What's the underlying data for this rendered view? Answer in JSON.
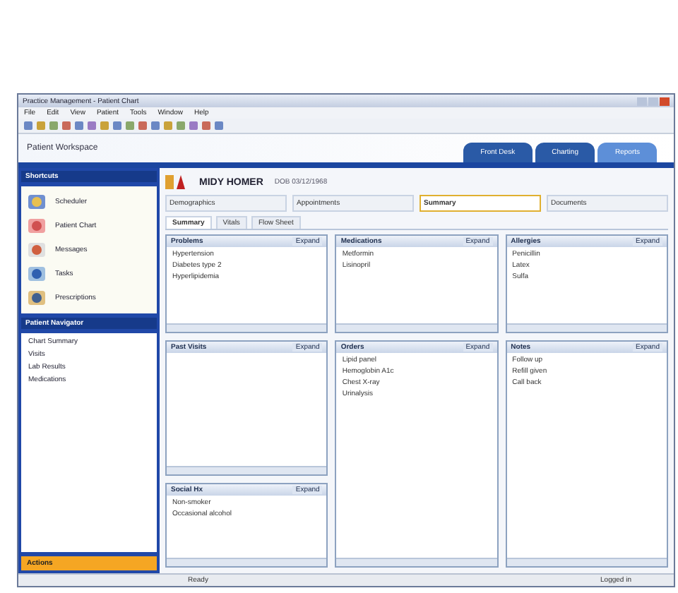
{
  "window": {
    "title": "Practice Management - Patient Chart"
  },
  "menu": [
    "File",
    "Edit",
    "View",
    "Patient",
    "Tools",
    "Window",
    "Help"
  ],
  "app_title": "Patient Workspace",
  "nav_tabs": [
    {
      "label": "Front Desk",
      "selected": false
    },
    {
      "label": "Charting",
      "selected": false
    },
    {
      "label": "Reports",
      "selected": true
    }
  ],
  "sidebar": {
    "title": "Shortcuts",
    "items": [
      "Scheduler",
      "Patient Chart",
      "Messages",
      "Tasks",
      "Prescriptions"
    ],
    "navigator": {
      "title": "Patient Navigator",
      "items": [
        "Chart Summary",
        "Visits",
        "Lab Results",
        "Medications"
      ]
    },
    "footer": "Actions"
  },
  "patient": {
    "name": "MIDY HOMER",
    "info": "DOB 03/12/1968"
  },
  "chart_tabs": [
    {
      "label": "Demographics",
      "selected": false
    },
    {
      "label": "Appointments",
      "selected": false
    },
    {
      "label": "Summary",
      "selected": true
    },
    {
      "label": "Documents",
      "selected": false
    }
  ],
  "sub_tabs": [
    {
      "label": "Summary",
      "selected": true
    },
    {
      "label": "Vitals",
      "selected": false
    },
    {
      "label": "Flow Sheet",
      "selected": false
    }
  ],
  "panels": [
    {
      "title": "Problems",
      "action": "Expand",
      "lines": [
        "Hypertension",
        "Diabetes type 2",
        "Hyperlipidemia"
      ]
    },
    {
      "title": "Medications",
      "action": "Expand",
      "lines": [
        "Metformin",
        "Lisinopril"
      ]
    },
    {
      "title": "Allergies",
      "action": "Expand",
      "lines": [
        "Penicillin",
        "Latex",
        "Sulfa"
      ]
    },
    {
      "title": "Past Visits",
      "action": "Expand"
    },
    {
      "title": "Orders",
      "action": "Expand",
      "lines": [
        "Lipid panel",
        "Hemoglobin A1c",
        "Chest X-ray",
        "Urinalysis"
      ]
    },
    {
      "title": "Notes",
      "action": "Expand",
      "lines": [
        "Follow up",
        "Refill given",
        "Call back"
      ]
    },
    {
      "title": "Social Hx",
      "action": "Expand",
      "lines": [
        "Non-smoker",
        "Occasional alcohol"
      ]
    }
  ],
  "status_bar": [
    "Ready",
    "Logged in"
  ]
}
